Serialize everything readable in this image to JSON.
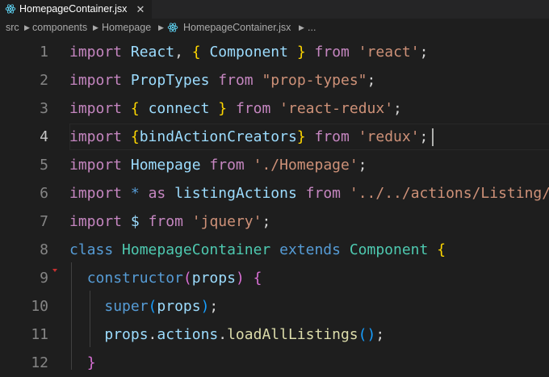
{
  "tab": {
    "title": "HomepageContainer.jsx",
    "close": "✕",
    "icon": "react-icon"
  },
  "breadcrumb": {
    "items": [
      "src",
      "components",
      "Homepage",
      "HomepageContainer.jsx",
      "..."
    ],
    "separator": "›"
  },
  "editor": {
    "active_line": "4",
    "lines": [
      {
        "n": "1",
        "tokens": [
          [
            "imp",
            "import"
          ],
          [
            "pl",
            " "
          ],
          [
            "var",
            "React"
          ],
          [
            "pl",
            ", "
          ],
          [
            "b1",
            "{"
          ],
          [
            "pl",
            " "
          ],
          [
            "var",
            "Component"
          ],
          [
            "pl",
            " "
          ],
          [
            "b1",
            "}"
          ],
          [
            "pl",
            " "
          ],
          [
            "imp",
            "from"
          ],
          [
            "pl",
            " "
          ],
          [
            "str",
            "'react'"
          ],
          [
            "pl",
            ";"
          ]
        ]
      },
      {
        "n": "2",
        "tokens": [
          [
            "imp",
            "import"
          ],
          [
            "pl",
            " "
          ],
          [
            "var",
            "PropTypes"
          ],
          [
            "pl",
            " "
          ],
          [
            "imp",
            "from"
          ],
          [
            "pl",
            " "
          ],
          [
            "str",
            "\"prop-types\""
          ],
          [
            "pl",
            ";"
          ]
        ]
      },
      {
        "n": "3",
        "tokens": [
          [
            "imp",
            "import"
          ],
          [
            "pl",
            " "
          ],
          [
            "b1",
            "{"
          ],
          [
            "pl",
            " "
          ],
          [
            "var",
            "connect"
          ],
          [
            "pl",
            " "
          ],
          [
            "b1",
            "}"
          ],
          [
            "pl",
            " "
          ],
          [
            "imp",
            "from"
          ],
          [
            "pl",
            " "
          ],
          [
            "str",
            "'react-redux'"
          ],
          [
            "pl",
            ";"
          ]
        ]
      },
      {
        "n": "4",
        "tokens": [
          [
            "imp",
            "import"
          ],
          [
            "pl",
            " "
          ],
          [
            "b1",
            "{"
          ],
          [
            "var",
            "bindActionCreators"
          ],
          [
            "b1",
            "}"
          ],
          [
            "pl",
            " "
          ],
          [
            "imp",
            "from"
          ],
          [
            "pl",
            " "
          ],
          [
            "str",
            "'redux'"
          ],
          [
            "pl",
            ";"
          ]
        ]
      },
      {
        "n": "5",
        "tokens": [
          [
            "imp",
            "import"
          ],
          [
            "pl",
            " "
          ],
          [
            "var",
            "Homepage"
          ],
          [
            "pl",
            " "
          ],
          [
            "imp",
            "from"
          ],
          [
            "pl",
            " "
          ],
          [
            "str",
            "'./Homepage'"
          ],
          [
            "pl",
            ";"
          ]
        ]
      },
      {
        "n": "6",
        "tokens": [
          [
            "imp",
            "import"
          ],
          [
            "pl",
            " "
          ],
          [
            "kw",
            "*"
          ],
          [
            "pl",
            " "
          ],
          [
            "imp",
            "as"
          ],
          [
            "pl",
            " "
          ],
          [
            "var",
            "listingActions"
          ],
          [
            "pl",
            " "
          ],
          [
            "imp",
            "from"
          ],
          [
            "pl",
            " "
          ],
          [
            "str",
            "'../../actions/Listing/"
          ]
        ]
      },
      {
        "n": "7",
        "tokens": [
          [
            "imp",
            "import"
          ],
          [
            "pl",
            " "
          ],
          [
            "var",
            "$"
          ],
          [
            "pl",
            " "
          ],
          [
            "imp",
            "from"
          ],
          [
            "pl",
            " "
          ],
          [
            "str",
            "'jquery'"
          ],
          [
            "pl",
            ";"
          ]
        ]
      },
      {
        "n": "8",
        "tokens": [
          [
            "kw",
            "class"
          ],
          [
            "pl",
            " "
          ],
          [
            "cls",
            "HomepageContainer"
          ],
          [
            "pl",
            " "
          ],
          [
            "kw",
            "extends"
          ],
          [
            "pl",
            " "
          ],
          [
            "cls",
            "Component"
          ],
          [
            "pl",
            " "
          ],
          [
            "b1",
            "{"
          ]
        ]
      },
      {
        "n": "9",
        "tokens": [
          [
            "pl",
            "  "
          ],
          [
            "kw",
            "constructor"
          ],
          [
            "b2",
            "("
          ],
          [
            "var",
            "props"
          ],
          [
            "b2",
            ")"
          ],
          [
            "pl",
            " "
          ],
          [
            "b2",
            "{"
          ]
        ]
      },
      {
        "n": "10",
        "tokens": [
          [
            "pl",
            "    "
          ],
          [
            "kw",
            "super"
          ],
          [
            "b3",
            "("
          ],
          [
            "var",
            "props"
          ],
          [
            "b3",
            ")"
          ],
          [
            "pl",
            ";"
          ]
        ]
      },
      {
        "n": "11",
        "tokens": [
          [
            "pl",
            "    "
          ],
          [
            "var",
            "props"
          ],
          [
            "pl",
            "."
          ],
          [
            "var",
            "actions"
          ],
          [
            "pl",
            "."
          ],
          [
            "fn",
            "loadAllListings"
          ],
          [
            "b3",
            "("
          ],
          [
            "b3",
            ")"
          ],
          [
            "pl",
            ";"
          ]
        ]
      },
      {
        "n": "12",
        "tokens": [
          [
            "pl",
            "  "
          ],
          [
            "b2",
            "}"
          ]
        ]
      }
    ]
  }
}
